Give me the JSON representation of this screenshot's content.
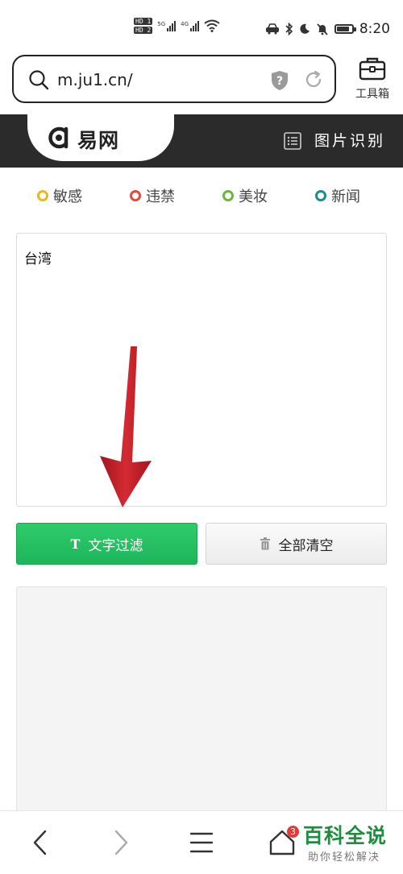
{
  "status_bar": {
    "sim1": "HD 1",
    "sim2": "HD 2",
    "net1": "5G",
    "net2": "4G",
    "battery_level": 0.85,
    "time": "8:20"
  },
  "browser": {
    "url": "m.ju1.cn/",
    "toolbox_label": "工具箱",
    "icons": [
      "search-icon",
      "shield-icon",
      "reload-icon",
      "toolbox-icon"
    ]
  },
  "site_header": {
    "logo_text": "易网",
    "title": "图片识别"
  },
  "categories": [
    {
      "label": "敏感",
      "color": "#e8b91c"
    },
    {
      "label": "违禁",
      "color": "#e4493f"
    },
    {
      "label": "美妆",
      "color": "#6cb33f"
    },
    {
      "label": "新闻",
      "color": "#1a8c8c"
    }
  ],
  "input": {
    "value": "台湾"
  },
  "buttons": {
    "filter_icon": "T",
    "filter_label": "文字过滤",
    "clear_label": "全部清空"
  },
  "annotation": {
    "arrow_color": "#c8202a"
  },
  "bottom_nav": {
    "tab_count": "3",
    "icons": [
      "back-icon",
      "forward-icon",
      "menu-icon",
      "home-icon"
    ]
  },
  "watermark": {
    "main": "百科全说",
    "sub": "助你轻松解决"
  }
}
